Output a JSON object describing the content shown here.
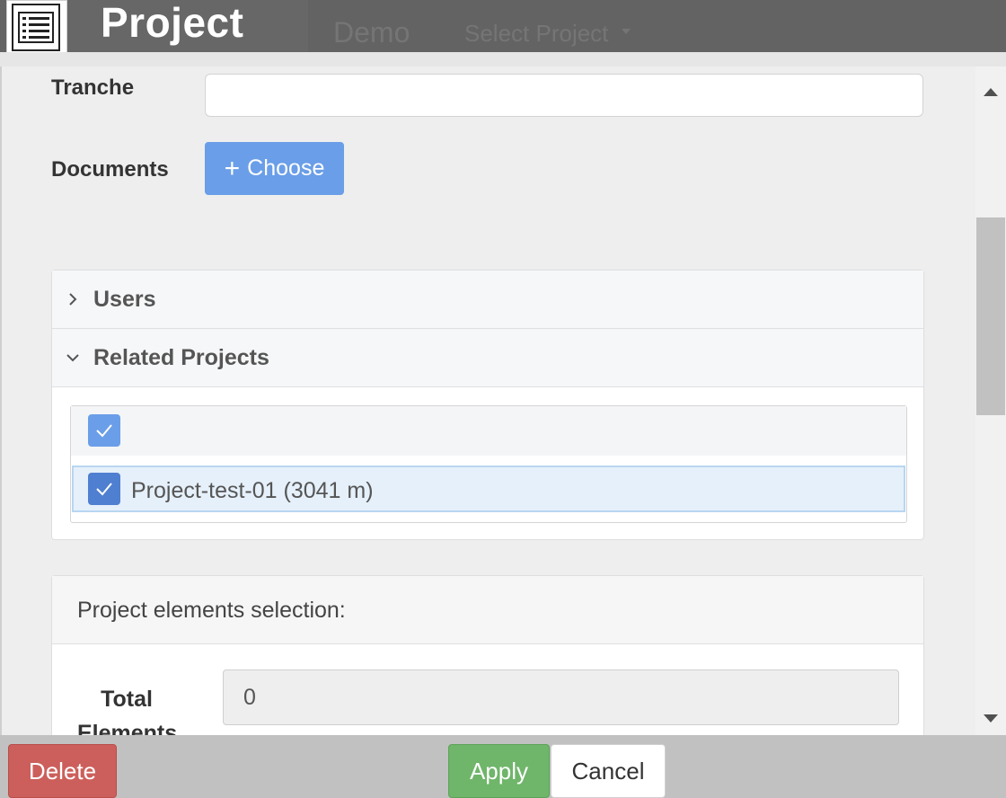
{
  "header": {
    "title": "Project",
    "nav_demo": "Demo",
    "nav_select_project": "Select Project"
  },
  "form": {
    "tranche_label": "Tranche",
    "tranche_value": "",
    "documents_label": "Documents",
    "choose_label": "Choose"
  },
  "accordion": {
    "users_label": "Users",
    "related_projects_label": "Related Projects",
    "related_projects": [
      {
        "label": "Project-test-01 (3041 m)",
        "checked": true
      }
    ],
    "select_all_checked": true
  },
  "elements_panel": {
    "title": "Project elements selection:",
    "total_label": "Total Elements",
    "total_value": "0"
  },
  "footer": {
    "delete_label": "Delete",
    "apply_label": "Apply",
    "cancel_label": "Cancel"
  },
  "colors": {
    "primary": "#6a9ee8",
    "danger": "#cc5f5b",
    "success": "#6fb56a",
    "checkbox": "#5b8ad8",
    "header_bg": "#636363"
  }
}
